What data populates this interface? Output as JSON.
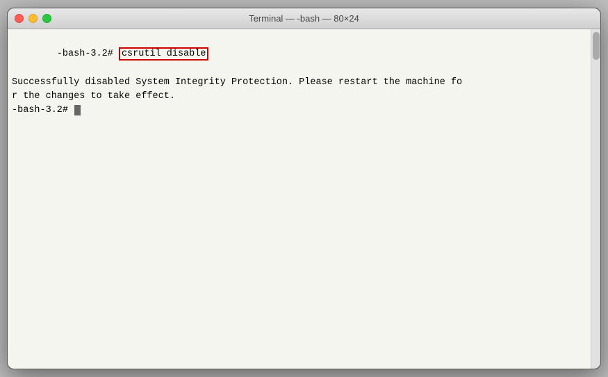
{
  "window": {
    "title": "Terminal — -bash — 80×24",
    "controls": {
      "close": "close",
      "minimize": "minimize",
      "maximize": "maximize"
    }
  },
  "terminal": {
    "lines": [
      {
        "type": "command",
        "prompt": "-bash-3.2# ",
        "command": "csrutil disable"
      },
      {
        "type": "output",
        "text": "Successfully disabled System Integrity Protection. Please restart the machine fo"
      },
      {
        "type": "output",
        "text": "r the changes to take effect."
      },
      {
        "type": "prompt_only",
        "prompt": "-bash-3.2# "
      }
    ]
  }
}
